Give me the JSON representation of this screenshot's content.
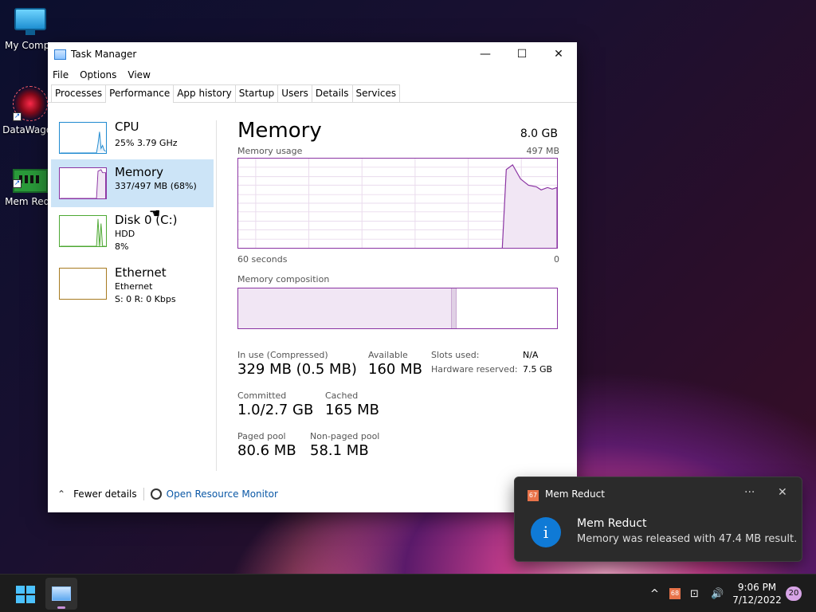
{
  "desktop": {
    "icons": [
      {
        "label": "My Compu"
      },
      {
        "label": "DataWagon"
      },
      {
        "label": "Mem Redu"
      }
    ]
  },
  "window": {
    "title": "Task Manager",
    "controls": {
      "minimize": "—",
      "maximize": "☐",
      "close": "✕"
    },
    "menu": [
      "File",
      "Options",
      "View"
    ],
    "tabs": [
      "Processes",
      "Performance",
      "App history",
      "Startup",
      "Users",
      "Details",
      "Services"
    ],
    "active_tab": "Performance"
  },
  "sidebar": {
    "items": [
      {
        "name": "CPU",
        "line1": "25%  3.79 GHz",
        "line2": "",
        "color": "#1f8ad0"
      },
      {
        "name": "Memory",
        "line1": "337/497 MB (68%)",
        "line2": "",
        "color": "#8b34a3"
      },
      {
        "name": "Disk 0 (C:)",
        "line1": "HDD",
        "line2": "8%",
        "color": "#4da833"
      },
      {
        "name": "Ethernet",
        "line1": "Ethernet",
        "line2": "S: 0  R: 0 Kbps",
        "color": "#a77a20"
      }
    ]
  },
  "memory": {
    "title": "Memory",
    "total": "8.0 GB",
    "usage_label": "Memory usage",
    "usage_max": "497 MB",
    "time_left": "60 seconds",
    "time_right": "0",
    "composition_label": "Memory composition",
    "stats": {
      "in_use_label": "In use (Compressed)",
      "in_use_value": "329 MB (0.5 MB)",
      "available_label": "Available",
      "available_value": "160 MB",
      "committed_label": "Committed",
      "committed_value": "1.0/2.7 GB",
      "cached_label": "Cached",
      "cached_value": "165 MB",
      "paged_label": "Paged pool",
      "paged_value": "80.6 MB",
      "nonpaged_label": "Non-paged pool",
      "nonpaged_value": "58.1 MB",
      "slots_label": "Slots used:",
      "slots_value": "N/A",
      "hw_label": "Hardware reserved:",
      "hw_value": "7.5 GB"
    },
    "composition_in_use_fraction": 0.67
  },
  "footer": {
    "fewer_details": "Fewer details",
    "open_resource_monitor": "Open Resource Monitor"
  },
  "toast": {
    "app_badge": "67",
    "app_name": "Mem Reduct",
    "more": "···",
    "close": "✕",
    "heading": "Mem Reduct",
    "body": "Memory was released with 47.4 MB result.",
    "info_glyph": "i"
  },
  "taskbar": {
    "tray_chevron": "^",
    "tray_memreduct": "68",
    "time": "9:06 PM",
    "date": "7/12/2022",
    "notif_count": "20"
  }
}
